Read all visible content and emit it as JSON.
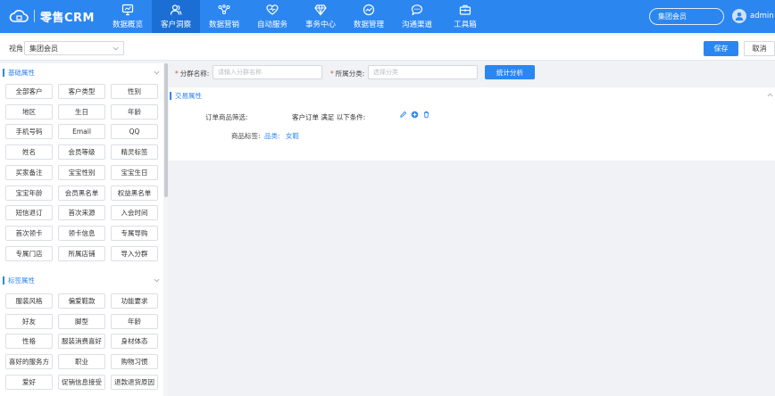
{
  "app": {
    "logo_text": "零售CRM"
  },
  "nav": [
    {
      "label": "数据概览",
      "icon": "monitor-icon"
    },
    {
      "label": "客户洞察",
      "icon": "users-icon",
      "active": true
    },
    {
      "label": "数据营销",
      "icon": "network-icon"
    },
    {
      "label": "自动服务",
      "icon": "heart-icon"
    },
    {
      "label": "事务中心",
      "icon": "diamond-icon"
    },
    {
      "label": "数据管理",
      "icon": "trend-icon"
    },
    {
      "label": "沟通渠道",
      "icon": "chat-icon"
    },
    {
      "label": "工具箱",
      "icon": "toolbox-icon"
    }
  ],
  "header": {
    "brand_select": "集团会员",
    "user": "admin"
  },
  "toolbar": {
    "view_label": "视角:",
    "view_value": "集团会员",
    "save": "保存",
    "cancel": "取消"
  },
  "sidebar": {
    "basic": {
      "title": "基础属性",
      "items": [
        "全部客户",
        "客户类型",
        "性别",
        "地区",
        "生日",
        "年龄",
        "手机号码",
        "Email",
        "QQ",
        "姓名",
        "会员等级",
        "精灵标签",
        "买家备注",
        "宝宝性别",
        "宝宝生日",
        "宝宝年龄",
        "会员黑名单",
        "权益黑名单",
        "短信退订",
        "首次来源",
        "入会时间",
        "首次领卡",
        "领卡信息",
        "专属导购",
        "专属门店",
        "所属店铺",
        "导入分群"
      ]
    },
    "tags": {
      "title": "标签属性",
      "items": [
        "服装风格",
        "偏爱鞋款",
        "功能要求",
        "好友",
        "脚型",
        "年龄",
        "性格",
        "服装消费喜好",
        "身材体态",
        "喜好的服务方",
        "职业",
        "购物习惯",
        "爱好",
        "促销信息接受",
        "退款退货原因"
      ]
    }
  },
  "filter": {
    "group_name_label": "分群名称:",
    "group_name_placeholder": "请输入分群名称",
    "category_label": "所属分类:",
    "category_placeholder": "选择分类",
    "stats_button": "统计分析"
  },
  "panel": {
    "title": "交易属性",
    "order_filter_label": "订单商品筛选:",
    "rule_text": "客户订单 满足 以下条件:",
    "product_tag_label": "商品标签:",
    "tag_category": "品类:",
    "tag_value": "女鞋"
  },
  "colors": {
    "primary": "#2b86f0",
    "nav_active": "#1b6fd4",
    "required": "#e24b3b"
  }
}
